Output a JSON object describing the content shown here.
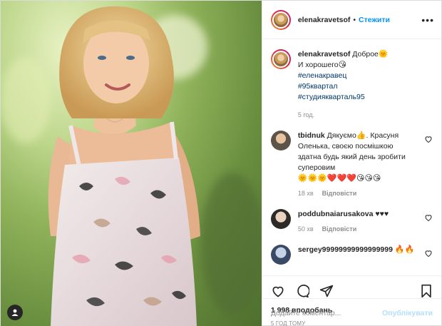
{
  "header": {
    "username": "elenakravetsof",
    "separator": "•",
    "follow_label": "Стежити",
    "more_label": "•••"
  },
  "caption": {
    "username": "elenakravetsof",
    "line1": "Доброе",
    "line1_emoji": "🌞",
    "line2": "И хорошего",
    "line2_emoji": "😘",
    "tags": [
      "#еленакравец",
      "#95квартал",
      "#студиякварталь95"
    ],
    "time": "5 год."
  },
  "comments": [
    {
      "username": "tbidnuk",
      "text_a": "Дякуємо",
      "emoji_a": "👍",
      "text_b": ". Красуня Оленька, своєю посмішкою здатна будь який день зробити суперовим",
      "emoji_b": "🌞🌞🌞❤️❤️❤️😘😘😘",
      "time": "18 хв",
      "reply_label": "Відповісти"
    },
    {
      "username": "poddubnaiarusakova",
      "text_a": "♥♥♥",
      "time": "50 хв",
      "reply_label": "Відповісти"
    },
    {
      "username": "sergey99999999999999999",
      "text_a": "🔥🔥"
    }
  ],
  "stats": {
    "likes": "1 998 вподобань",
    "posted": "5 год тому"
  },
  "add_comment": {
    "placeholder": "Додайте коментар...",
    "publish_label": "Опублікувати"
  },
  "colors": {
    "link": "#0095f6",
    "hashtag": "#00376b",
    "muted": "#8e8e8e",
    "publish_disabled": "#b2dffc"
  },
  "icons": [
    "user-tag-icon",
    "more-icon",
    "heart-icon",
    "comment-icon",
    "share-icon",
    "bookmark-icon"
  ]
}
